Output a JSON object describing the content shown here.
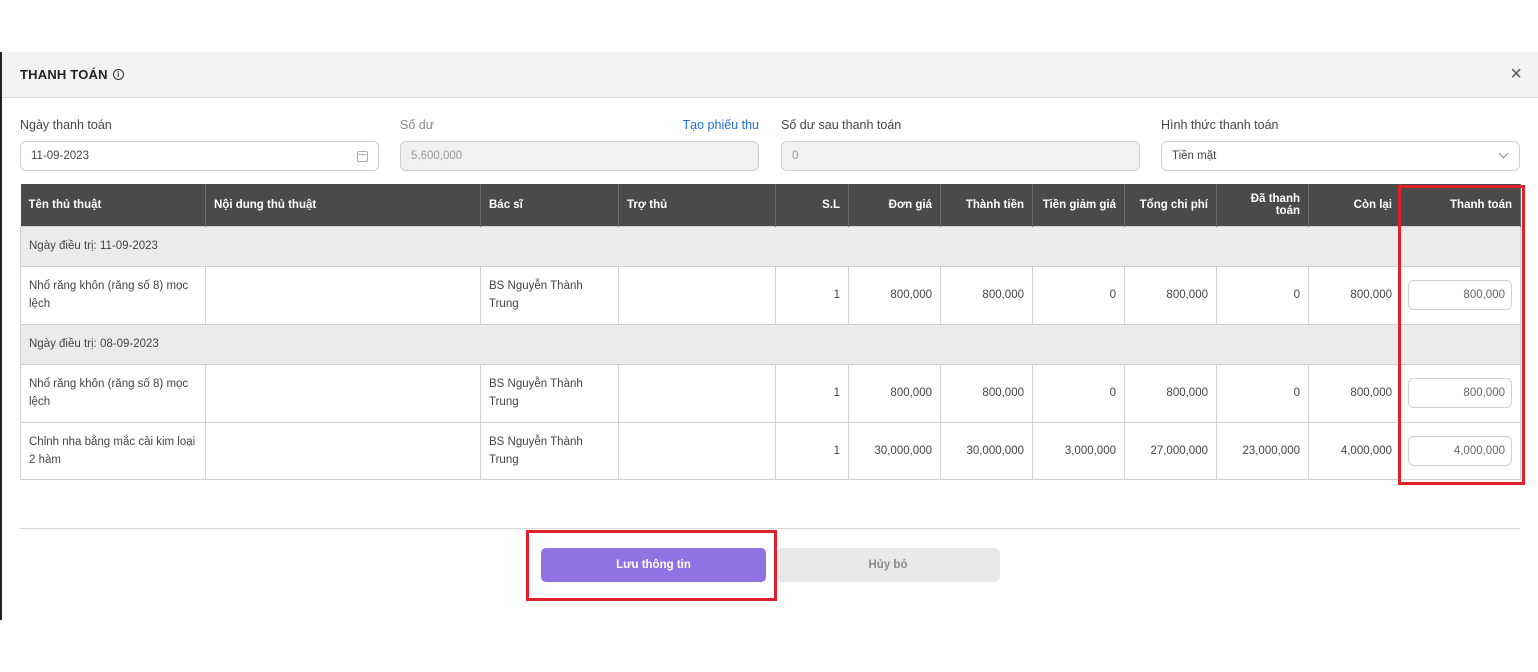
{
  "modal": {
    "title": "THANH TOÁN",
    "info_icon": "ⓘ",
    "close_icon": "×"
  },
  "form": {
    "payment_date": {
      "label": "Ngày thanh toán",
      "value": "11-09-2023"
    },
    "balance": {
      "label": "Số dư",
      "value": "5,600,000",
      "link": "Tạo phiếu thu"
    },
    "balance_after": {
      "label": "Số dư sau thanh toán",
      "value": "0"
    },
    "payment_method": {
      "label": "Hình thức thanh toán",
      "value": "Tiền mặt"
    }
  },
  "table": {
    "headers": [
      "Tên thủ thuật",
      "Nội dung thủ thuật",
      "Bác sĩ",
      "Trợ thủ",
      "S.L",
      "Đơn giá",
      "Thành tiền",
      "Tiền giảm giá",
      "Tổng chi phí",
      "Đã thanh toán",
      "Còn lại",
      "Thanh toán"
    ],
    "groups": [
      {
        "label": "Ngày điều trị: 11-09-2023",
        "rows": [
          {
            "name": "Nhổ răng khôn (răng số 8) mọc lệch",
            "content": "",
            "doctor": "BS Nguyễn Thành Trung",
            "assistant": "",
            "qty": "1",
            "unit_price": "800,000",
            "amount": "800,000",
            "discount": "0",
            "total": "800,000",
            "paid": "0",
            "remaining": "800,000",
            "payment": "800,000"
          }
        ]
      },
      {
        "label": "Ngày điều trị: 08-09-2023",
        "rows": [
          {
            "name": "Nhổ răng khôn (răng số 8) mọc lệch",
            "content": "",
            "doctor": "BS Nguyễn Thành Trung",
            "assistant": "",
            "qty": "1",
            "unit_price": "800,000",
            "amount": "800,000",
            "discount": "0",
            "total": "800,000",
            "paid": "0",
            "remaining": "800,000",
            "payment": "800,000"
          },
          {
            "name": "Chỉnh nha bằng mắc cài kim loại 2 hàm",
            "content": "",
            "doctor": "BS Nguyễn Thành Trung",
            "assistant": "",
            "qty": "1",
            "unit_price": "30,000,000",
            "amount": "30,000,000",
            "discount": "3,000,000",
            "total": "27,000,000",
            "paid": "23,000,000",
            "remaining": "4,000,000",
            "payment": "4,000,000"
          }
        ]
      }
    ]
  },
  "footer": {
    "save_label": "Lưu thông tin",
    "cancel_label": "Hủy bỏ"
  },
  "colors": {
    "header_bg": "#4a4a4a",
    "primary": "#8f73e3",
    "highlight": "#e0202a",
    "link": "#1e6fd9"
  }
}
